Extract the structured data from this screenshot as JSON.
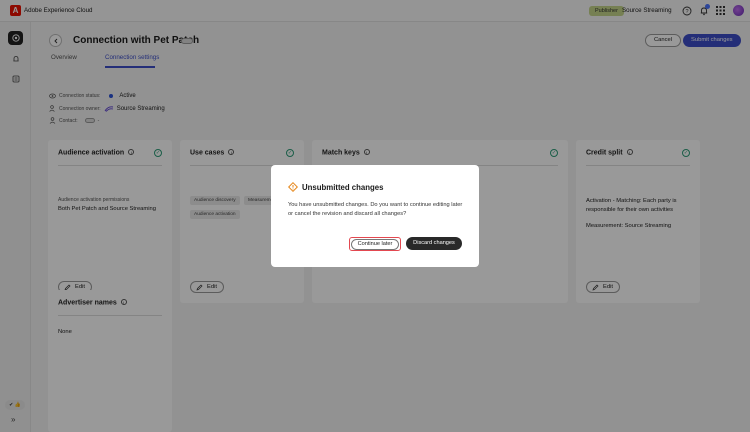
{
  "app": {
    "brand": "Adobe Experience Cloud",
    "brand_mark": "A"
  },
  "topbar": {
    "org_badge": "Publisher",
    "org_name": "Source Streaming",
    "notifications": "2"
  },
  "page": {
    "title": "Connection with Pet Patch",
    "cancel": "Cancel",
    "submit": "Submit changes",
    "tabs": [
      "Overview",
      "Connection settings"
    ]
  },
  "meta": {
    "status_label": "Connection status:",
    "status_value": "Active",
    "owner_label": "Connection owner:",
    "owner_value": "Source Streaming",
    "contact_label": "Contact:",
    "contact_value": "-"
  },
  "cards": {
    "audience_activation": {
      "title": "Audience activation",
      "permissions_label": "Audience activation permissions",
      "permissions_value": "Both Pet Patch and Source Streaming",
      "edit": "Edit"
    },
    "use_cases": {
      "title": "Use cases",
      "tags": [
        "Audience discovery",
        "Measurement",
        "Audience activation"
      ],
      "edit": "Edit"
    },
    "match_keys": {
      "title": "Match keys"
    },
    "credit_split": {
      "title": "Credit split",
      "activation": "Activation - Matching: Each party is responsible for their own activities",
      "measurement": "Measurement: Source Streaming",
      "edit": "Edit"
    },
    "advertiser_names": {
      "title": "Advertiser names",
      "value": "None"
    }
  },
  "dialog": {
    "title": "Unsubmitted changes",
    "body": "You have unsubmitted changes. Do you want to continue editing later or cancel the revision and discard all changes?",
    "continue": "Continue later",
    "discard": "Discard changes"
  },
  "colors": {
    "accent": "#3d4ec9",
    "check": "#2d9d78",
    "warning": "#e68619",
    "focus": "#e34850",
    "badge": "#c5d68a"
  }
}
